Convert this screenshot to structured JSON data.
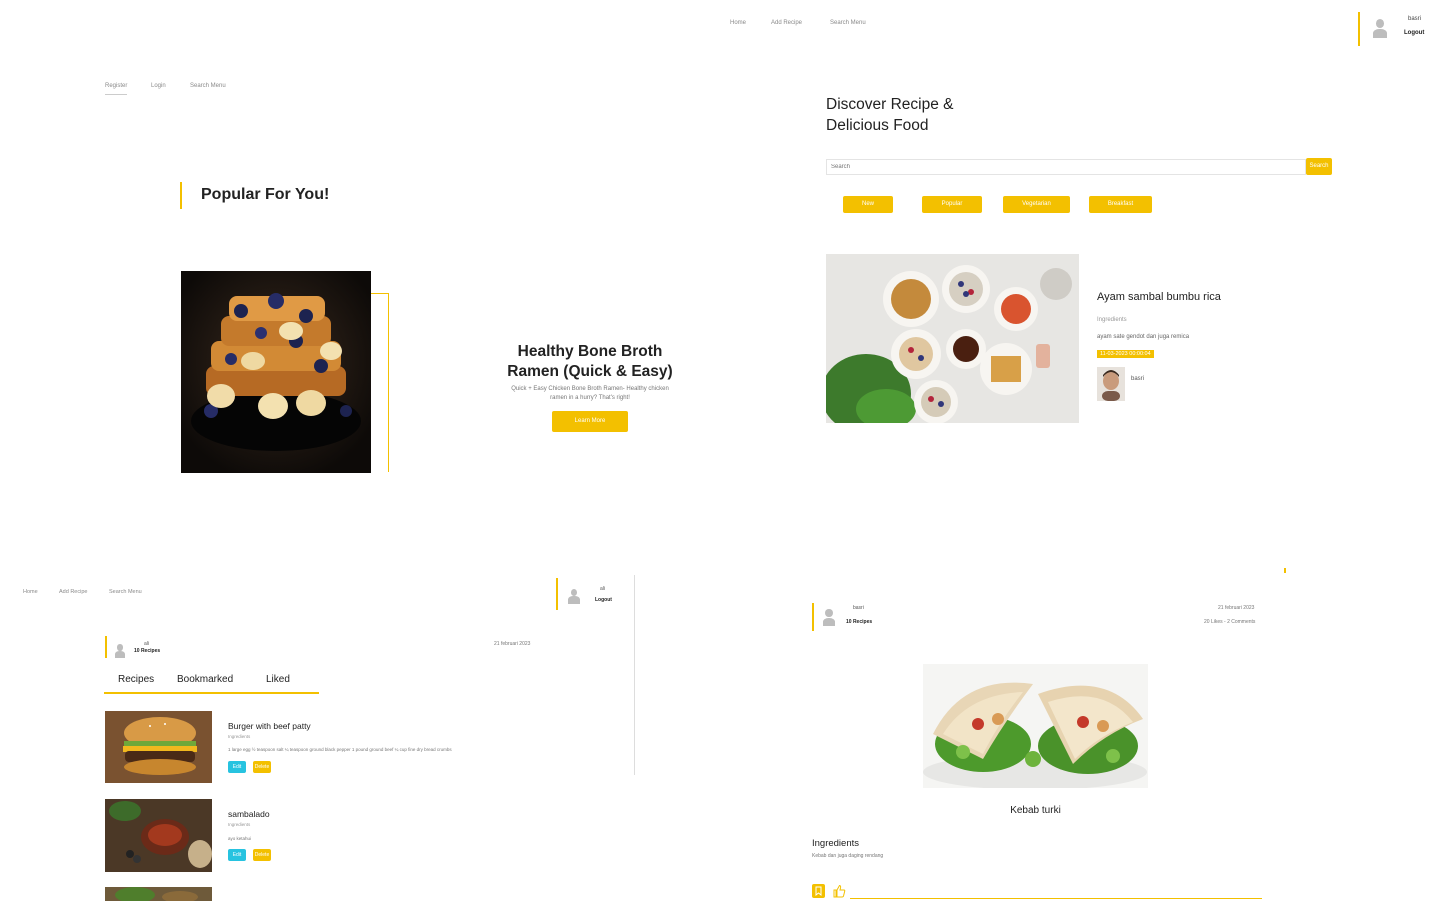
{
  "top_nav": {
    "home": "Home",
    "add_recipe": "Add Recipe",
    "search_menu": "Search Menu"
  },
  "top_user": {
    "name": "basri",
    "logout": "Logout"
  },
  "auth_nav": {
    "register": "Register",
    "login": "Login",
    "search_menu": "Search Menu"
  },
  "popular": {
    "heading": "Popular For You!"
  },
  "featured": {
    "title": "Healthy Bone Broth Ramen (Quick & Easy)",
    "description": "Quick + Easy Chicken Bone Broth Ramen- Healthy chicken ramen in a hurry? That's right!",
    "button": "Learn More"
  },
  "discover": {
    "heading": "Discover Recipe & Delicious Food",
    "search_placeholder": "Search",
    "search_button": "Search",
    "filters": [
      "New",
      "Popular",
      "Vegetarian",
      "Breakfast"
    ]
  },
  "recipe_card": {
    "title": "Ayam sambal bumbu rica",
    "ingredients_label": "Ingredients",
    "ingredients_text": "ayam sate gendot dan juga remica",
    "date_badge": "11-03-2023 00:00:04",
    "author": "basri"
  },
  "profile_nav": {
    "home": "Home",
    "add_recipe": "Add Recipe",
    "search_menu": "Search Menu"
  },
  "profile_user": {
    "name": "ali",
    "logout": "Logout"
  },
  "profile": {
    "name": "ali",
    "recipes_count": "10 Recipes",
    "date": "21 februari 2023",
    "tabs": [
      "Recipes",
      "Bookmarked",
      "Liked"
    ],
    "items": [
      {
        "title": "Burger with beef patty",
        "label": "Ingredients",
        "text": "1 large egg ½ teaspoon salt ¼ teaspoon ground black pepper 1 pound ground beef ¼ cup fine dry bread crumbs",
        "edit": "Edit",
        "delete": "Delete"
      },
      {
        "title": "sambalado",
        "label": "Ingredients",
        "text": "ayo ketahui",
        "edit": "Edit",
        "delete": "Delete"
      }
    ]
  },
  "detail": {
    "author": "basri",
    "recipes_count": "10 Recipes",
    "date": "21 februari 2023",
    "stats": "20 Likes - 2 Comments",
    "title": "Kebab turki",
    "ingredients_heading": "Ingredients",
    "ingredients_text": "Kebab dan juga daging rendang"
  },
  "colors": {
    "accent": "#f3c000",
    "edit": "#27c3e0"
  }
}
